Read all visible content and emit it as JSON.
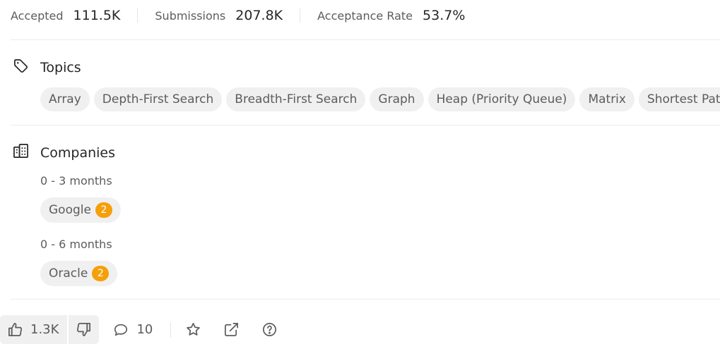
{
  "stats": {
    "accepted_label": "Accepted",
    "accepted_value": "111.5K",
    "submissions_label": "Submissions",
    "submissions_value": "207.8K",
    "acceptance_label": "Acceptance Rate",
    "acceptance_value": "53.7%"
  },
  "topics": {
    "title": "Topics",
    "icon": "tag-icon",
    "tags": [
      "Array",
      "Depth-First Search",
      "Breadth-First Search",
      "Graph",
      "Heap (Priority Queue)",
      "Matrix",
      "Shortest Path"
    ]
  },
  "companies": {
    "title": "Companies",
    "icon": "building-icon",
    "groups": [
      {
        "period": "0 - 3 months",
        "companies": [
          {
            "name": "Google",
            "count": "2"
          }
        ]
      },
      {
        "period": "0 - 6 months",
        "companies": [
          {
            "name": "Oracle",
            "count": "2"
          }
        ]
      }
    ]
  },
  "actions": {
    "upvotes": "1.3K",
    "comments": "10",
    "icons": [
      "thumbs-up-icon",
      "thumbs-down-icon",
      "comment-icon",
      "star-icon",
      "share-icon",
      "help-icon"
    ]
  },
  "colors": {
    "badge": "#f5a00a",
    "tag_bg": "#f0f0f0",
    "divider": "#ececec"
  }
}
